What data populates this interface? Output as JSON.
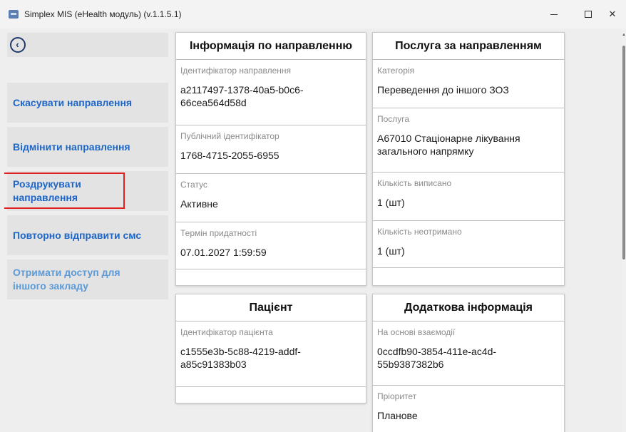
{
  "window": {
    "title": "Simplex MIS (eHealth модуль) (v.1.1.5.1)",
    "close_glyph": "✕"
  },
  "sidebar": {
    "back_icon": "‹",
    "buttons": [
      {
        "label": "Скасувати направлення",
        "enabled": true
      },
      {
        "label": "Відмінити направлення",
        "enabled": true
      },
      {
        "label": "Роздрукувати направлення",
        "enabled": true
      },
      {
        "label": "Повторно відправити смс",
        "enabled": true
      },
      {
        "label": "Отримати доступ для іншого закладу",
        "enabled": false
      }
    ]
  },
  "cards": {
    "referral_info": {
      "title": "Інформація по направленню",
      "fields": [
        {
          "label": "Ідентифікатор направлення",
          "value": "a2117497-1378-40a5-b0c6-66cea564d58d"
        },
        {
          "label": "Публічний ідентифікатор",
          "value": "1768-4715-2055-6955"
        },
        {
          "label": "Статус",
          "value": "Активне"
        },
        {
          "label": "Термін придатності",
          "value": "07.01.2027 1:59:59"
        }
      ]
    },
    "referral_service": {
      "title": "Послуга за направленням",
      "fields": [
        {
          "label": "Категорія",
          "value": "Переведення до іншого ЗОЗ"
        },
        {
          "label": "Послуга",
          "value": "A67010 Стаціонарне лікування загального напрямку"
        },
        {
          "label": "Кількість виписано",
          "value": "1 (шт)"
        },
        {
          "label": "Кількість неотримано",
          "value": "1 (шт)"
        }
      ]
    },
    "patient": {
      "title": "Пацієнт",
      "fields": [
        {
          "label": "Ідентифікатор пацієнта",
          "value": "c1555e3b-5c88-4219-addf-a85c91383b03"
        }
      ]
    },
    "additional": {
      "title": "Додаткова інформація",
      "fields": [
        {
          "label": "На основі взаємодії",
          "value": "0ccdfb90-3854-411e-ac4d-55b9387382b6"
        },
        {
          "label": "Пріоритет",
          "value": "Планове"
        }
      ]
    }
  },
  "colors": {
    "accent": "#1d66c8",
    "disabled": "#5b9ad8",
    "highlight": "#e02020"
  }
}
